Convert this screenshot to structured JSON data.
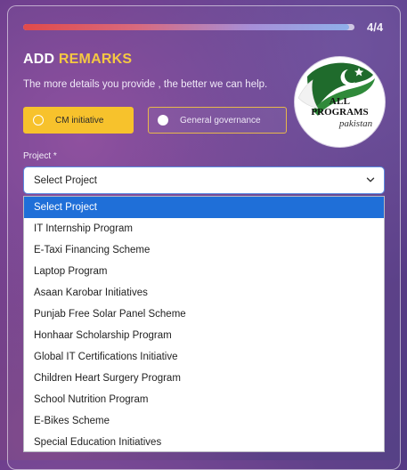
{
  "progress": {
    "step": "4/4",
    "fraction": 0.985
  },
  "form": {
    "title_part1": "ADD ",
    "title_part2": "REMARKS",
    "subtitle": "The more details you provide , the better we can help.",
    "options": [
      {
        "label": "CM initiative",
        "state": "active"
      },
      {
        "label": "General governance",
        "state": "inactive"
      }
    ],
    "project_label": "Project *",
    "select_value": "Select Project"
  },
  "dropdown": {
    "items": [
      "Select Project",
      "IT Internship Program",
      "E-Taxi Financing Scheme",
      "Laptop Program",
      "Asaan Karobar Initiatives",
      "Punjab Free Solar Panel Scheme",
      "Honhaar Scholarship Program",
      "Global IT Certifications Initiative",
      "Children Heart Surgery Program",
      "School Nutrition Program",
      "E-Bikes Scheme",
      "Special Education Initiatives"
    ],
    "selected_index": 0
  },
  "logo": {
    "line1": "ALL",
    "line2": "PROGRAMS",
    "line3": "pakistan"
  },
  "colors": {
    "accent_yellow": "#f7c22c",
    "title_yellow": "#f5c842",
    "highlight_blue": "#1f6fd8",
    "select_border": "#5b8be0"
  }
}
